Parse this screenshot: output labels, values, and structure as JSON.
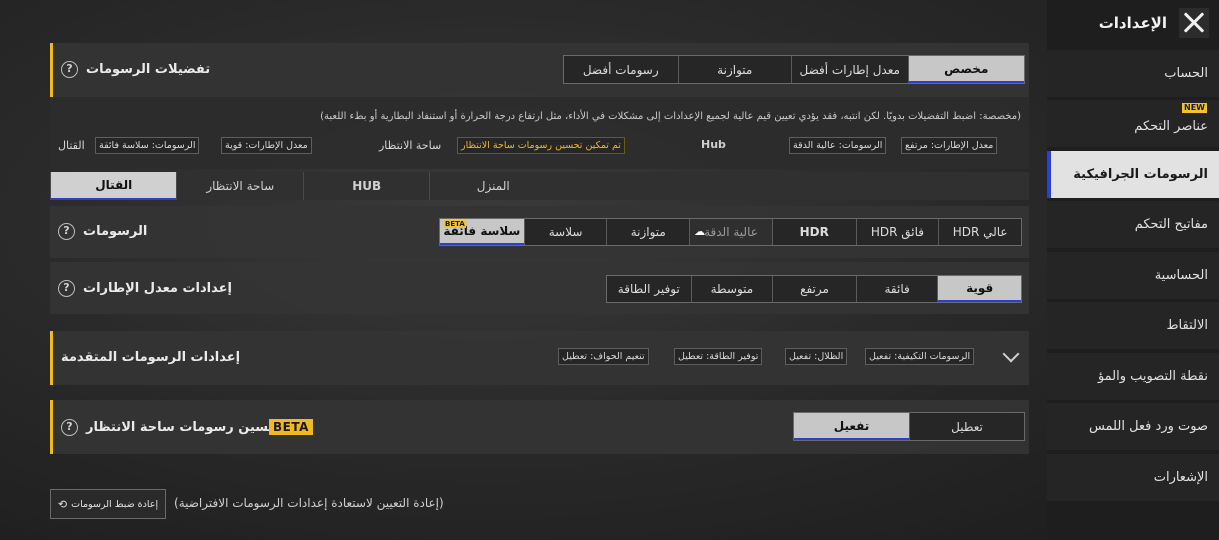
{
  "sidebar": {
    "title": "الإعدادات",
    "items": [
      {
        "label": "الحساب",
        "badge": ""
      },
      {
        "label": "عناصر التحكم",
        "badge": "NEW"
      },
      {
        "label": "الرسومات الجرافيكية",
        "badge": ""
      },
      {
        "label": "مفاتيح التحكم",
        "badge": ""
      },
      {
        "label": "الحساسية",
        "badge": ""
      },
      {
        "label": "الالتقاط",
        "badge": ""
      },
      {
        "label": "نقطة التصويب والمؤ",
        "badge": ""
      },
      {
        "label": "صوت ورد فعل اللمس",
        "badge": ""
      },
      {
        "label": "الإشعارات",
        "badge": ""
      }
    ]
  },
  "prefs": {
    "title": "تفضيلات الرسومات",
    "help": "?",
    "options": [
      "مخصص",
      "معدل إطارات أفضل",
      "متوازنة",
      "رسومات أفضل"
    ],
    "selected_index": 0,
    "description": "(مخصصة: اضبط التفضيلات بدويًا. لكن انتبه، فقد يؤدي تعيين قيم عالية لجميع الإعدادات إلى مشكلات في الأداء، مثل ارتفاع درجة الحرارة أو استنفاد البطارية أو بطء اللعبة)",
    "hub": {
      "label": "Hub",
      "graphics": "الرسومات: عالية الدقة",
      "fps": "معدل الإطارات: مرتفع"
    },
    "lobby": {
      "label": "ساحة الانتظار",
      "note": "تم تمكين تحسين رسومات ساحة الانتظار"
    },
    "combat": {
      "label": "القتال",
      "graphics": "الرسومات: سلاسة فائقة",
      "fps": "معدل الإطارات: قوية"
    }
  },
  "tabs": {
    "items": [
      "القتال",
      "ساحة الانتظار",
      "HUB",
      "المنزل"
    ],
    "selected_index": 0
  },
  "graphics": {
    "title": "الرسومات",
    "options": [
      "عالي HDR",
      "فائق HDR",
      "HDR",
      "عالية الدقة",
      "متوازنة",
      "سلاسة",
      "سلاسة فائقة"
    ],
    "selected_index": 6,
    "beta_label": "BETA"
  },
  "fps": {
    "title": "إعدادات معدل الإطارات",
    "options": [
      "قوية",
      "فائقة",
      "مرتفع",
      "متوسطة",
      "توفير الطاقة"
    ],
    "selected_index": 0
  },
  "advanced": {
    "title": "إعدادات الرسومات المتقدمة",
    "chips": [
      "الرسومات التكيفية: تفعيل",
      "الظلال: تفعيل",
      "توفير الطاقة: تعطيل",
      "تنعيم الحواف: تعطيل"
    ]
  },
  "lobby_enhance": {
    "title": "تحسين رسومات ساحة الانتظار",
    "beta": "BETA",
    "options": [
      "تعطيل",
      "تفعيل"
    ],
    "selected_index": 1
  },
  "reset": {
    "button": "إعادة ضبط الرسومات",
    "note": "(إعادة التعيين لاستعادة إعدادات الرسومات الافتراضية)"
  },
  "colors": {
    "accent": "#f2b81f",
    "selected_underline": "#2b3fd6",
    "selected_bg": "#c7c7c7"
  }
}
